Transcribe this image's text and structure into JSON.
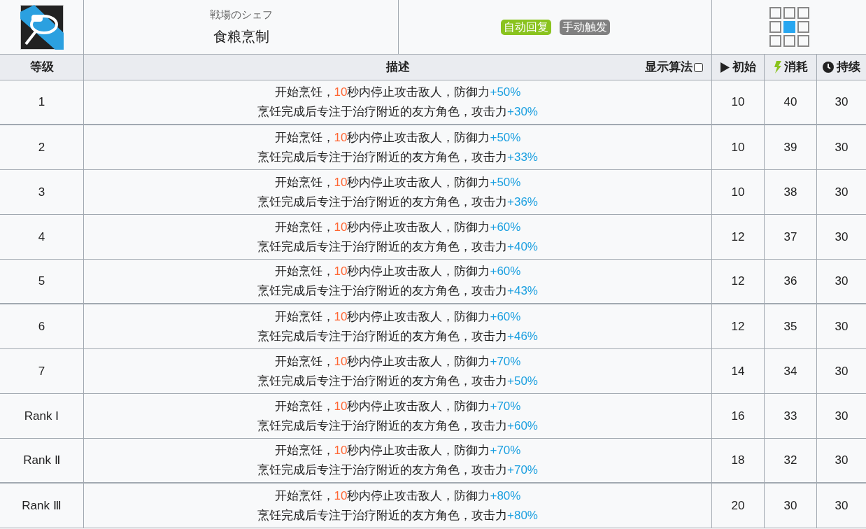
{
  "skill": {
    "subtitle": "戦場のシェフ",
    "name": "食粮烹制",
    "tags": [
      {
        "label": "自动回复",
        "color": "#8ac31e"
      },
      {
        "label": "手动触发",
        "color": "#808080"
      }
    ],
    "range": [
      [
        false,
        false,
        false
      ],
      [
        false,
        true,
        false
      ],
      [
        false,
        false,
        false
      ]
    ]
  },
  "columns": {
    "level": "等级",
    "description": "描述",
    "show_formula": {
      "label": "显示算法",
      "checked": false
    },
    "initial": "初始",
    "cost": "消耗",
    "duration": "持续"
  },
  "rows": [
    {
      "level": "1",
      "group_end": true,
      "lines": [
        [
          {
            "kind": "plain",
            "text": "开始烹饪，"
          },
          {
            "kind": "time",
            "text": "10"
          },
          {
            "kind": "plain",
            "text": "秒内停止攻击敌人，防御力"
          },
          {
            "kind": "bonus",
            "text": "+50%"
          }
        ],
        [
          {
            "kind": "plain",
            "text": "烹饪完成后专注于治疗附近的友方角色，攻击力"
          },
          {
            "kind": "bonus",
            "text": "+30%"
          }
        ]
      ],
      "initial": "10",
      "cost": "40",
      "duration": "30"
    },
    {
      "level": "2",
      "group_end": false,
      "lines": [
        [
          {
            "kind": "plain",
            "text": "开始烹饪，"
          },
          {
            "kind": "time",
            "text": "10"
          },
          {
            "kind": "plain",
            "text": "秒内停止攻击敌人，防御力"
          },
          {
            "kind": "bonus",
            "text": "+50%"
          }
        ],
        [
          {
            "kind": "plain",
            "text": "烹饪完成后专注于治疗附近的友方角色，攻击力"
          },
          {
            "kind": "bonus",
            "text": "+33%"
          }
        ]
      ],
      "initial": "10",
      "cost": "39",
      "duration": "30"
    },
    {
      "level": "3",
      "group_end": false,
      "lines": [
        [
          {
            "kind": "plain",
            "text": "开始烹饪，"
          },
          {
            "kind": "time",
            "text": "10"
          },
          {
            "kind": "plain",
            "text": "秒内停止攻击敌人，防御力"
          },
          {
            "kind": "bonus",
            "text": "+50%"
          }
        ],
        [
          {
            "kind": "plain",
            "text": "烹饪完成后专注于治疗附近的友方角色，攻击力"
          },
          {
            "kind": "bonus",
            "text": "+36%"
          }
        ]
      ],
      "initial": "10",
      "cost": "38",
      "duration": "30"
    },
    {
      "level": "4",
      "group_end": false,
      "lines": [
        [
          {
            "kind": "plain",
            "text": "开始烹饪，"
          },
          {
            "kind": "time",
            "text": "10"
          },
          {
            "kind": "plain",
            "text": "秒内停止攻击敌人，防御力"
          },
          {
            "kind": "bonus",
            "text": "+60%"
          }
        ],
        [
          {
            "kind": "plain",
            "text": "烹饪完成后专注于治疗附近的友方角色，攻击力"
          },
          {
            "kind": "bonus",
            "text": "+40%"
          }
        ]
      ],
      "initial": "12",
      "cost": "37",
      "duration": "30"
    },
    {
      "level": "5",
      "group_end": true,
      "lines": [
        [
          {
            "kind": "plain",
            "text": "开始烹饪，"
          },
          {
            "kind": "time",
            "text": "10"
          },
          {
            "kind": "plain",
            "text": "秒内停止攻击敌人，防御力"
          },
          {
            "kind": "bonus",
            "text": "+60%"
          }
        ],
        [
          {
            "kind": "plain",
            "text": "烹饪完成后专注于治疗附近的友方角色，攻击力"
          },
          {
            "kind": "bonus",
            "text": "+43%"
          }
        ]
      ],
      "initial": "12",
      "cost": "36",
      "duration": "30"
    },
    {
      "level": "6",
      "group_end": false,
      "lines": [
        [
          {
            "kind": "plain",
            "text": "开始烹饪，"
          },
          {
            "kind": "time",
            "text": "10"
          },
          {
            "kind": "plain",
            "text": "秒内停止攻击敌人，防御力"
          },
          {
            "kind": "bonus",
            "text": "+60%"
          }
        ],
        [
          {
            "kind": "plain",
            "text": "烹饪完成后专注于治疗附近的友方角色，攻击力"
          },
          {
            "kind": "bonus",
            "text": "+46%"
          }
        ]
      ],
      "initial": "12",
      "cost": "35",
      "duration": "30"
    },
    {
      "level": "7",
      "group_end": false,
      "lines": [
        [
          {
            "kind": "plain",
            "text": "开始烹饪，"
          },
          {
            "kind": "time",
            "text": "10"
          },
          {
            "kind": "plain",
            "text": "秒内停止攻击敌人，防御力"
          },
          {
            "kind": "bonus",
            "text": "+70%"
          }
        ],
        [
          {
            "kind": "plain",
            "text": "烹饪完成后专注于治疗附近的友方角色，攻击力"
          },
          {
            "kind": "bonus",
            "text": "+50%"
          }
        ]
      ],
      "initial": "14",
      "cost": "34",
      "duration": "30"
    },
    {
      "level": "Rank Ⅰ",
      "group_end": false,
      "lines": [
        [
          {
            "kind": "plain",
            "text": "开始烹饪，"
          },
          {
            "kind": "time",
            "text": "10"
          },
          {
            "kind": "plain",
            "text": "秒内停止攻击敌人，防御力"
          },
          {
            "kind": "bonus",
            "text": "+70%"
          }
        ],
        [
          {
            "kind": "plain",
            "text": "烹饪完成后专注于治疗附近的友方角色，攻击力"
          },
          {
            "kind": "bonus",
            "text": "+60%"
          }
        ]
      ],
      "initial": "16",
      "cost": "33",
      "duration": "30"
    },
    {
      "level": "Rank Ⅱ",
      "group_end": true,
      "lines": [
        [
          {
            "kind": "plain",
            "text": "开始烹饪，"
          },
          {
            "kind": "time",
            "text": "10"
          },
          {
            "kind": "plain",
            "text": "秒内停止攻击敌人，防御力"
          },
          {
            "kind": "bonus",
            "text": "+70%"
          }
        ],
        [
          {
            "kind": "plain",
            "text": "烹饪完成后专注于治疗附近的友方角色，攻击力"
          },
          {
            "kind": "bonus",
            "text": "+70%"
          }
        ]
      ],
      "initial": "18",
      "cost": "32",
      "duration": "30"
    },
    {
      "level": "Rank Ⅲ",
      "group_end": false,
      "lines": [
        [
          {
            "kind": "plain",
            "text": "开始烹饪，"
          },
          {
            "kind": "time",
            "text": "10"
          },
          {
            "kind": "plain",
            "text": "秒内停止攻击敌人，防御力"
          },
          {
            "kind": "bonus",
            "text": "+80%"
          }
        ],
        [
          {
            "kind": "plain",
            "text": "烹饪完成后专注于治疗附近的友方角色，攻击力"
          },
          {
            "kind": "bonus",
            "text": "+80%"
          }
        ]
      ],
      "initial": "20",
      "cost": "30",
      "duration": "30"
    }
  ]
}
